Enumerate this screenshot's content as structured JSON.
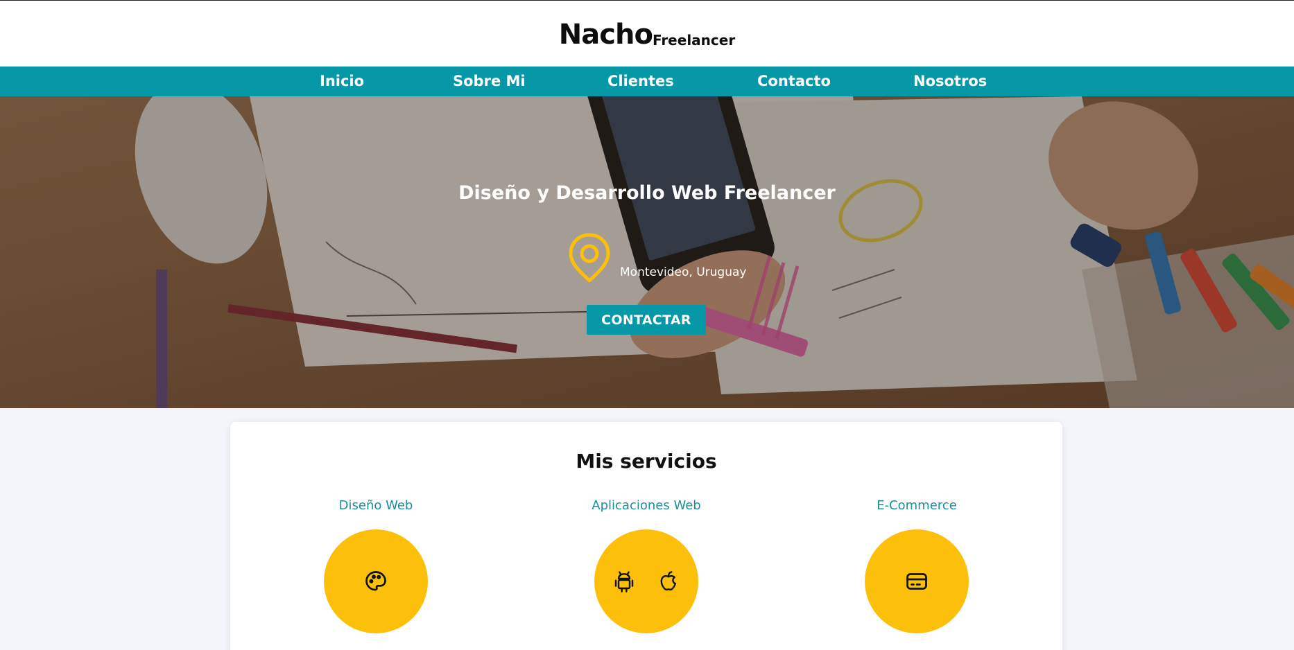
{
  "header": {
    "logo_main": "Nacho",
    "logo_sub": "Freelancer"
  },
  "nav": {
    "items": [
      {
        "label": "Inicio"
      },
      {
        "label": "Sobre Mi"
      },
      {
        "label": "Clientes"
      },
      {
        "label": "Contacto"
      },
      {
        "label": "Nosotros"
      }
    ]
  },
  "hero": {
    "title": "Diseño y Desarrollo Web Freelancer",
    "location": "Montevideo, Uruguay",
    "location_icon": "map-pin-icon",
    "cta_label": "CONTACTAR"
  },
  "services": {
    "title": "Mis servicios",
    "items": [
      {
        "label": "Diseño Web",
        "icons": [
          "palette-icon"
        ]
      },
      {
        "label": "Aplicaciones Web",
        "icons": [
          "android-icon",
          "apple-icon"
        ]
      },
      {
        "label": "E-Commerce",
        "icons": [
          "credit-card-icon"
        ]
      }
    ]
  },
  "colors": {
    "accent": "#0798a8",
    "highlight": "#fdc00a",
    "service_label": "#1b8e9c"
  }
}
